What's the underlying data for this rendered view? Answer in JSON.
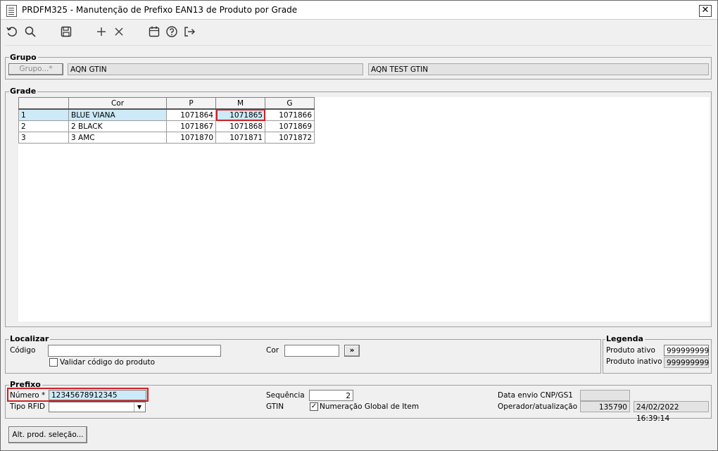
{
  "window": {
    "title": "PRDFM325 - Manutenção de Prefixo EAN13 de Produto por Grade",
    "close_label": "✕"
  },
  "toolbar": {
    "icons": [
      "refresh-icon",
      "search-icon",
      "save-icon",
      "add-icon",
      "delete-icon",
      "calendar-icon",
      "help-icon",
      "exit-icon"
    ]
  },
  "grupo": {
    "title": "Grupo",
    "button_label": "Grupo...*",
    "code": "AQN GTIN",
    "description": "AQN TEST GTIN"
  },
  "grade": {
    "title": "Grade",
    "columns": [
      "Cor",
      "P",
      "M",
      "G"
    ],
    "rows": [
      {
        "idx": "1",
        "cor": "BLUE VIANA",
        "p": "1071864",
        "m": "1071865",
        "g": "1071866"
      },
      {
        "idx": "2",
        "cor": "2 BLACK",
        "p": "1071867",
        "m": "1071868",
        "g": "1071869"
      },
      {
        "idx": "3",
        "cor": "3 AMC",
        "p": "1071870",
        "m": "1071871",
        "g": "1071872"
      }
    ]
  },
  "localizar": {
    "title": "Localizar",
    "codigo_label": "Código",
    "codigo_value": "",
    "validar_label": "Validar código do produto",
    "cor_label": "Cor",
    "cor_value": "",
    "go_label": "»"
  },
  "legenda": {
    "title": "Legenda",
    "ativo_label": "Produto ativo",
    "ativo_value": "999999999",
    "inativo_label": "Produto inativo",
    "inativo_value": "999999999"
  },
  "prefixo": {
    "title": "Prefixo",
    "numero_label": "Número *",
    "numero_value": "12345678912345",
    "tipo_rfid_label": "Tipo RFID",
    "tipo_rfid_value": "",
    "sequencia_label": "Sequência",
    "sequencia_value": "2",
    "gtin_label": "GTIN",
    "gtin_check_label": "Numeração Global de Item",
    "gtin_checked": "✓",
    "data_envio_label": "Data envio CNP/GS1",
    "data_envio_value": "",
    "operador_label": "Operador/atualização",
    "operador_value": "135790",
    "atualizacao_value": "24/02/2022 16:39:14"
  },
  "footer": {
    "alt_button_label": "Alt. prod. seleção..."
  }
}
